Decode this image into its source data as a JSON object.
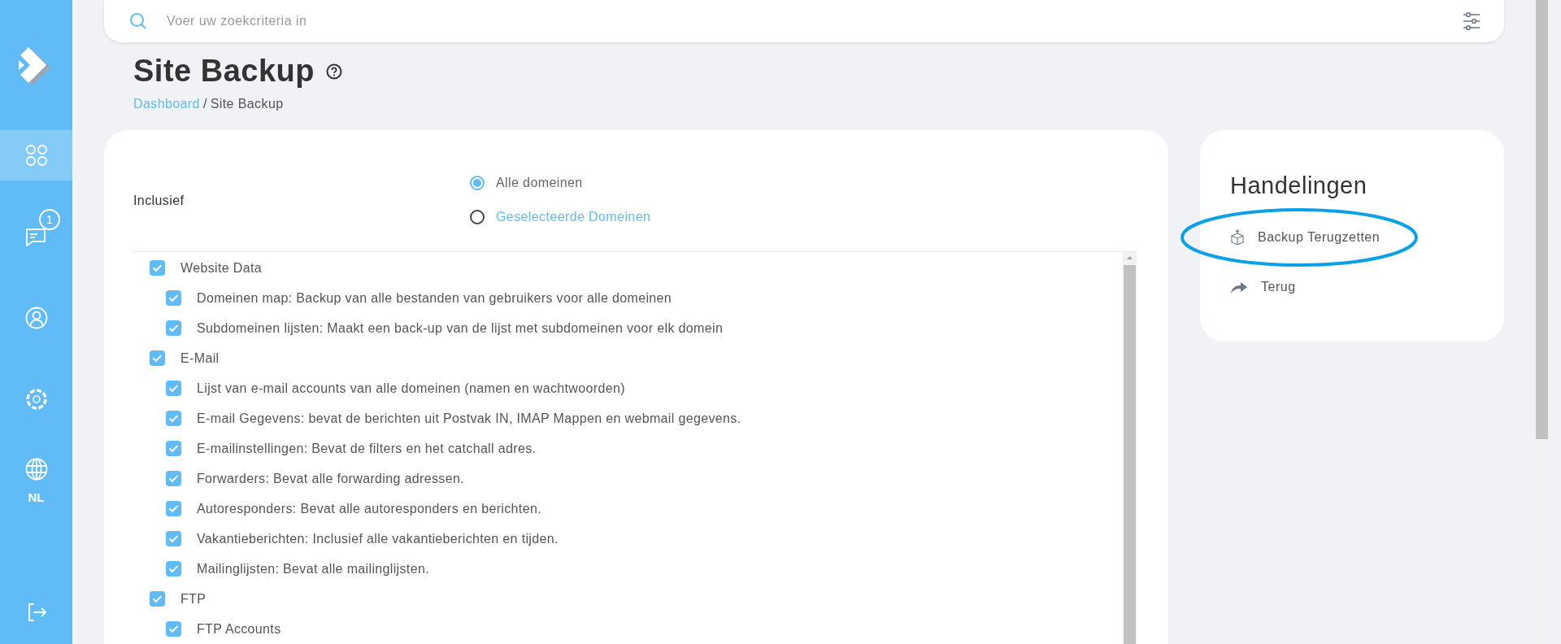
{
  "sidebar": {
    "items": [
      {
        "kind": "dashboard",
        "selected": true
      },
      {
        "kind": "messages",
        "selected": false,
        "badge": "1"
      },
      {
        "kind": "account",
        "selected": false
      },
      {
        "kind": "settings",
        "selected": false
      },
      {
        "kind": "language",
        "selected": false,
        "label": "NL"
      },
      {
        "kind": "logout",
        "selected": false
      }
    ]
  },
  "search": {
    "placeholder": "Voer uw zoekcriteria in"
  },
  "page": {
    "title": "Site Backup",
    "breadcrumb": [
      {
        "label": "Dashboard",
        "kind": "link"
      },
      {
        "label": "/",
        "kind": "separator"
      },
      {
        "label": "Site Backup",
        "kind": "current"
      }
    ]
  },
  "scope": {
    "label": "Inclusief",
    "options": [
      {
        "label": "Alle domeinen",
        "selected": true,
        "kind": "plain"
      },
      {
        "label": "Geselecteerde Domeinen",
        "selected": false,
        "kind": "link"
      }
    ]
  },
  "tree": [
    {
      "label": "Website Data",
      "checked": true,
      "children": [
        {
          "label": "Domeinen map: Backup van alle bestanden van gebruikers voor alle domeinen",
          "checked": true
        },
        {
          "label": "Subdomeinen lijsten: Maakt een back-up van de lijst met subdomeinen voor elk domein",
          "checked": true
        }
      ]
    },
    {
      "label": "E-Mail",
      "checked": true,
      "children": [
        {
          "label": "Lijst van e-mail accounts van alle domeinen (namen en wachtwoorden)",
          "checked": true
        },
        {
          "label": "E-mail Gegevens: bevat de berichten uit Postvak IN, IMAP Mappen en webmail gegevens.",
          "checked": true
        },
        {
          "label": "E-mailinstellingen: Bevat de filters en het catchall adres.",
          "checked": true
        },
        {
          "label": "Forwarders: Bevat alle forwarding adressen.",
          "checked": true
        },
        {
          "label": "Autoresponders: Bevat alle autoresponders en berichten.",
          "checked": true
        },
        {
          "label": "Vakantieberichten: Inclusief alle vakantieberichten en tijden.",
          "checked": true
        },
        {
          "label": "Mailinglijsten: Bevat alle mailinglijsten.",
          "checked": true
        }
      ]
    },
    {
      "label": "FTP",
      "checked": true,
      "children": [
        {
          "label": "FTP Accounts",
          "checked": true
        }
      ]
    }
  ],
  "actions": {
    "title": "Handelingen",
    "items": [
      {
        "kind": "restore",
        "label": "Backup Terugzetten",
        "circled": true
      },
      {
        "kind": "back",
        "label": "Terug",
        "circled": false
      }
    ]
  }
}
